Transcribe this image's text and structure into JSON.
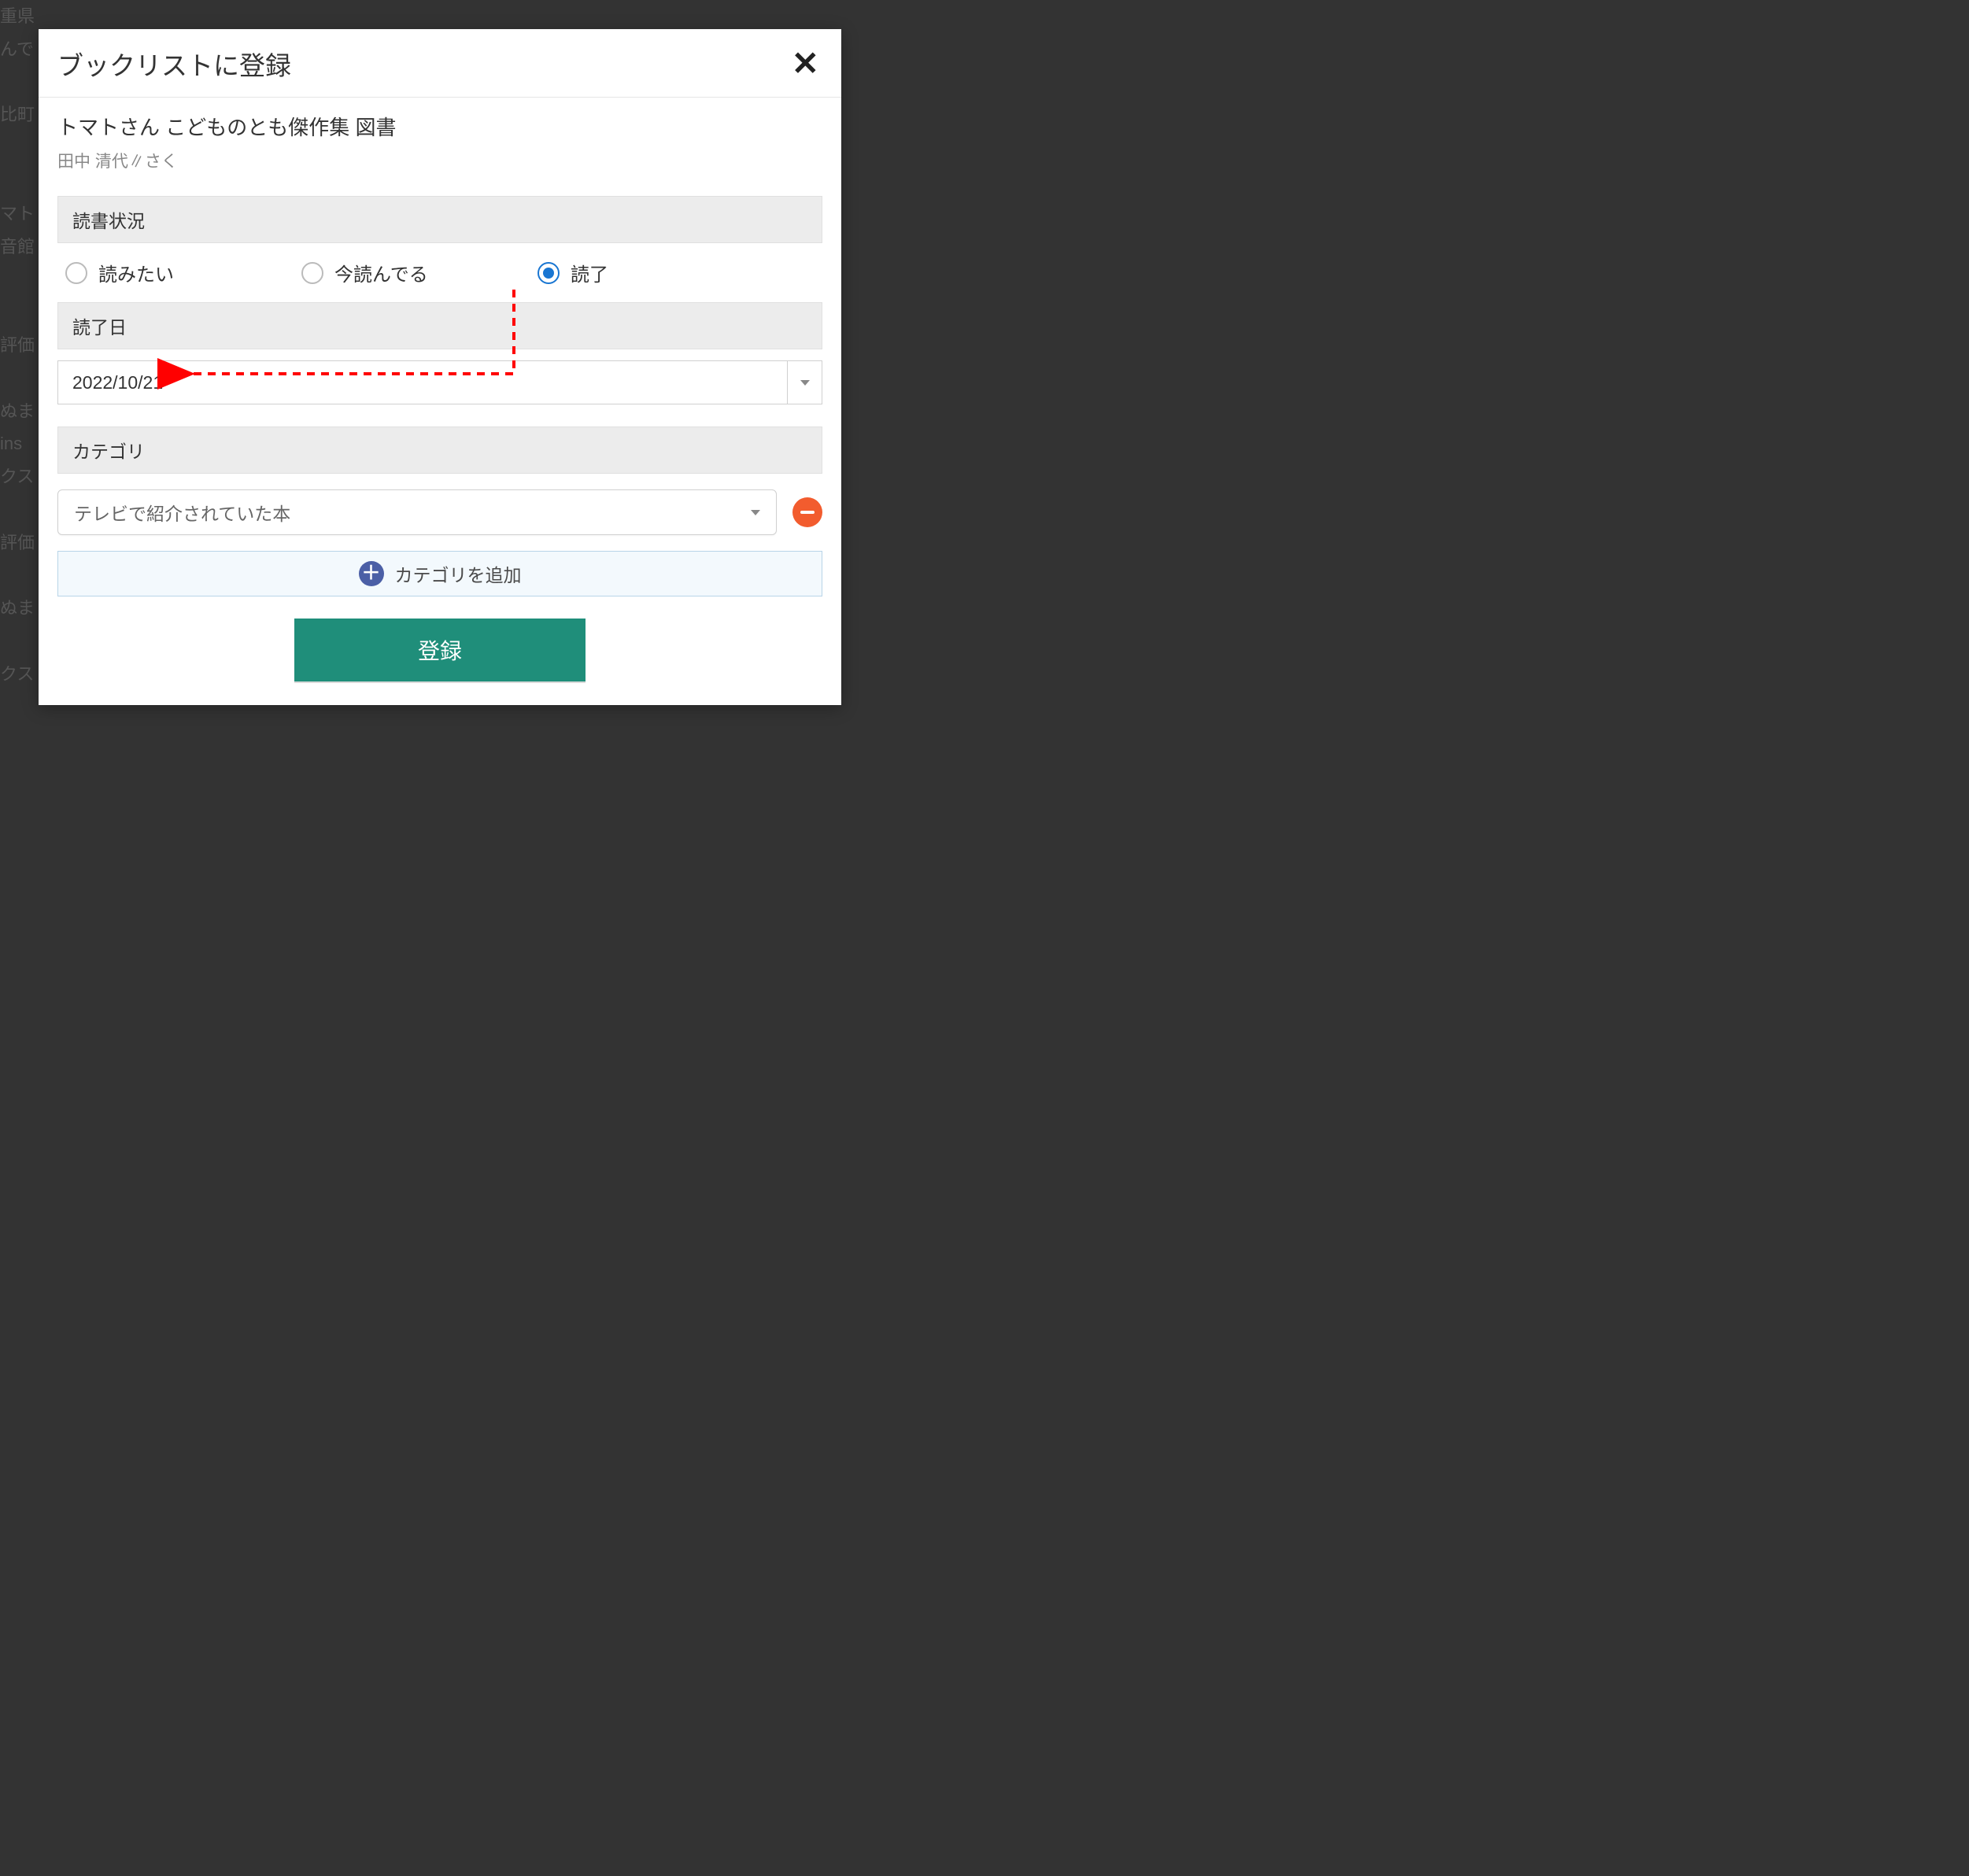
{
  "modal": {
    "title": "ブックリストに登録",
    "book_title": "トマトさん こどものとも傑作集 図書",
    "book_author": "田中 清代∥さく",
    "status": {
      "header": "読書状況",
      "options": [
        {
          "label": "読みたい",
          "checked": false
        },
        {
          "label": "今読んでる",
          "checked": false
        },
        {
          "label": "読了",
          "checked": true
        }
      ]
    },
    "finish_date": {
      "header": "読了日",
      "value": "2022/10/21"
    },
    "category": {
      "header": "カテゴリ",
      "selected": "テレビで紹介されていた本",
      "add_label": "カテゴリを追加"
    },
    "submit_label": "登録"
  },
  "background_fragments": "重県\nんで\n\n比町\n\n\nマト\n音館\n\n\n評価\n\nぬま\nins\nクス\n\n評価\n\nぬま\n\nクス",
  "annotation": {
    "color": "#ff0000"
  }
}
